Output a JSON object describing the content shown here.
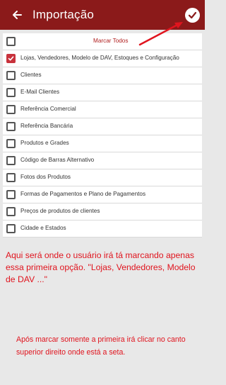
{
  "header": {
    "title": "Importação",
    "back_icon": "arrow-left-icon",
    "confirm_icon": "check-circle-icon",
    "background_color": "#8b1a1a"
  },
  "list": {
    "select_all_label": "Marcar Todos",
    "items": [
      {
        "label": "Lojas, Vendedores, Modelo de DAV, Estoques e Configuração",
        "checked": true
      },
      {
        "label": "Clientes",
        "checked": false
      },
      {
        "label": "E-Mail Clientes",
        "checked": false
      },
      {
        "label": "Referência Comercial",
        "checked": false
      },
      {
        "label": "Referência Bancária",
        "checked": false
      },
      {
        "label": "Produtos e Grades",
        "checked": false
      },
      {
        "label": "Código de Barras Alternativo",
        "checked": false
      },
      {
        "label": "Fotos dos Produtos",
        "checked": false
      },
      {
        "label": "Formas de Pagamentos e Plano de Pagamentos",
        "checked": false
      },
      {
        "label": "Preços de produtos de clientes",
        "checked": false
      },
      {
        "label": "Cidade e Estados",
        "checked": false
      }
    ]
  },
  "annotations": {
    "note1": "Aqui será onde o usuário irá tá marcando apenas essa primeira opção. \"Lojas, Vendedores, Modelo de DAV ...\"",
    "note2": "Após marcar somente a primeira irá clicar no canto superior direito onde está a seta.",
    "color": "#e0141e"
  }
}
